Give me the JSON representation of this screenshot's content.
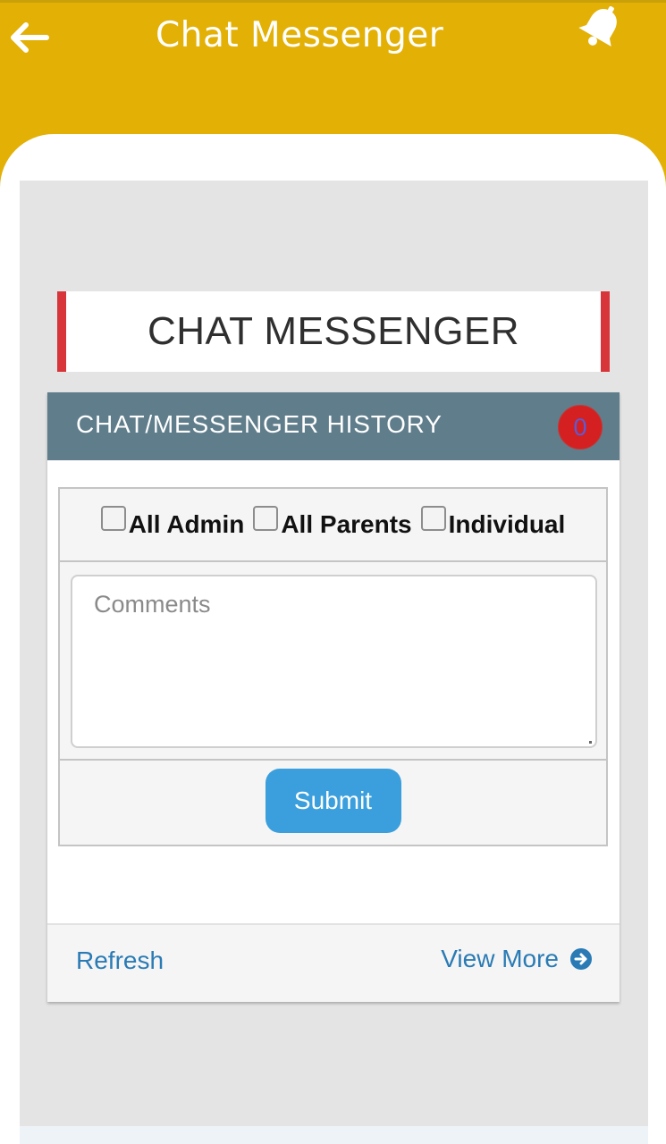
{
  "app_bar": {
    "title": "Chat Messenger",
    "back_icon": "arrow-left-icon",
    "notification_icon": "bell-icon",
    "color": "#e3b005"
  },
  "page": {
    "heading": "CHAT MESSENGER",
    "accent_color": "#d8353a"
  },
  "panel": {
    "title": "CHAT/MESSENGER HISTORY",
    "count": "0",
    "header_color": "#607d8b",
    "badge_color": "#d42020"
  },
  "form": {
    "recipients": [
      {
        "label": "All Admin",
        "checked": false
      },
      {
        "label": "All Parents",
        "checked": false
      },
      {
        "label": "Individual",
        "checked": false
      }
    ],
    "comments_placeholder": "Comments",
    "comments_value": "",
    "submit_label": "Submit",
    "submit_color": "#3a9fdc"
  },
  "footer": {
    "refresh_label": "Refresh",
    "view_more_label": "View More",
    "view_more_icon": "arrow-circle-right-icon",
    "link_color": "#2a7bb5"
  }
}
